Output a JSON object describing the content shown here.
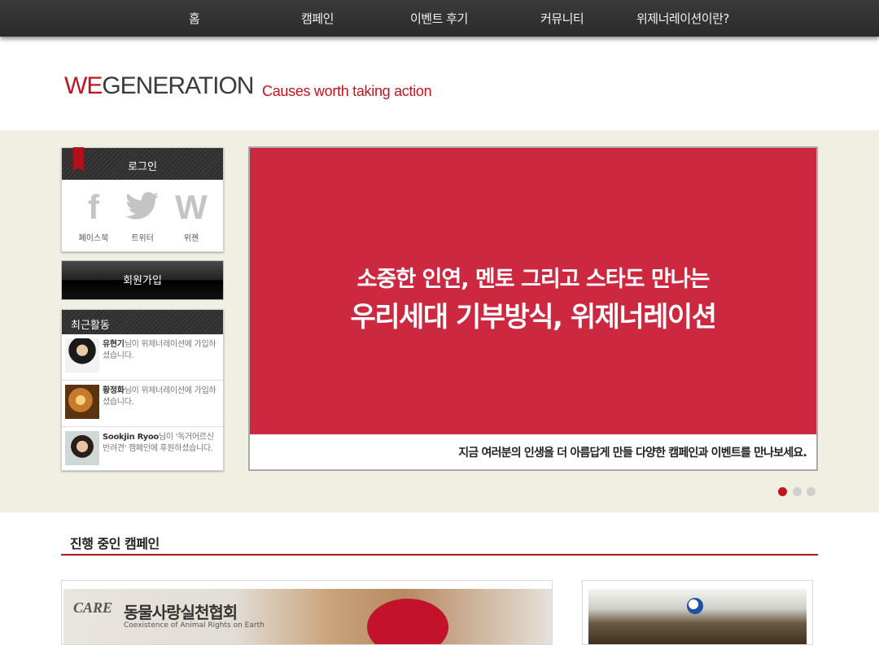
{
  "nav": {
    "items": [
      "홈",
      "캠페인",
      "이벤트 후기",
      "커뮤니티",
      "위제너레이션이란?"
    ]
  },
  "header": {
    "logo_we": "WE",
    "logo_rest": "GENERATION",
    "tagline": "Causes worth taking action"
  },
  "login": {
    "title": "로그인",
    "social": [
      {
        "icon": "facebook-icon",
        "glyph": "f",
        "label": "페이스북"
      },
      {
        "icon": "twitter-icon",
        "glyph": "🐦",
        "label": "트위터"
      },
      {
        "icon": "wegen-icon",
        "glyph": "W",
        "label": "위젠"
      }
    ]
  },
  "join": {
    "label": "회원가입"
  },
  "recent": {
    "title": "최근활동",
    "items": [
      {
        "name": "유현기",
        "text": "님이 위제너레이션에 가입하셨습니다."
      },
      {
        "name": "황정화",
        "text": "님이 위제너레이션에 가입하셨습니다."
      },
      {
        "name": "Sookjin Ryoo",
        "text": "님이 '독거어르신 반려견' 캠페인에 후원하셨습니다."
      }
    ]
  },
  "slider": {
    "line1": "소중한 인연, 멘토 그리고 스타도 만나는",
    "line2": "우리세대 기부방식, 위제너레이션",
    "caption": "지금 여러분의 인생을 더 아름답게 만들 다양한 캠페인과 이벤트를 만나보세요.",
    "active_slide": 1,
    "slide_count": 3
  },
  "campaigns": {
    "title": "진행 중인 캠페인",
    "card1": {
      "logo": "CARE",
      "org": "동물사랑실천협회",
      "org_en": "Coexistence of Animal Rights on Earth"
    }
  },
  "colors": {
    "brand_red": "#c2161f",
    "slide_red": "#cc2840",
    "band_beige": "#f0efe1",
    "nav_dark": "#2f2f2f"
  }
}
